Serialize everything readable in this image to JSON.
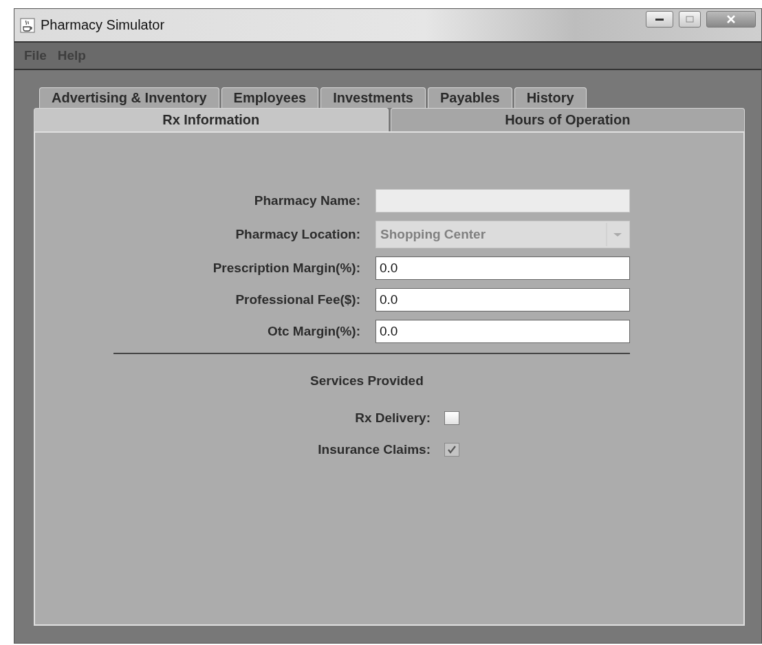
{
  "window": {
    "title": "Pharmacy Simulator"
  },
  "menu": [
    {
      "label": "File"
    },
    {
      "label": "Help"
    }
  ],
  "tab_rows": [
    [
      {
        "label": "Advertising & Inventory",
        "selected": false
      },
      {
        "label": "Employees",
        "selected": false
      },
      {
        "label": "Investments",
        "selected": false
      },
      {
        "label": "Payables",
        "selected": false
      },
      {
        "label": "History",
        "selected": false
      }
    ],
    [
      {
        "label": "Rx Information",
        "selected": true
      },
      {
        "label": "Hours of Operation",
        "selected": false
      }
    ]
  ],
  "fields": [
    {
      "kind": "text",
      "label": "Pharmacy Name:",
      "disabled": true
    },
    {
      "kind": "combo",
      "label": "Pharmacy Location:",
      "value": "Shopping Center",
      "disabled": true
    },
    {
      "kind": "text",
      "label": "Prescription Margin(%):",
      "value": "0.0",
      "disabled": false
    },
    {
      "kind": "text",
      "label": "Professional Fee($):",
      "value": "0.0",
      "disabled": false
    },
    {
      "kind": "text",
      "label": "Otc Margin(%):",
      "value": "0.0",
      "disabled": false
    }
  ],
  "services": {
    "title": "Services Provided",
    "options": [
      {
        "label": "Rx Delivery:",
        "checked": false,
        "disabled": false
      },
      {
        "label": "Insurance Claims:",
        "checked": true,
        "disabled": true
      }
    ]
  }
}
